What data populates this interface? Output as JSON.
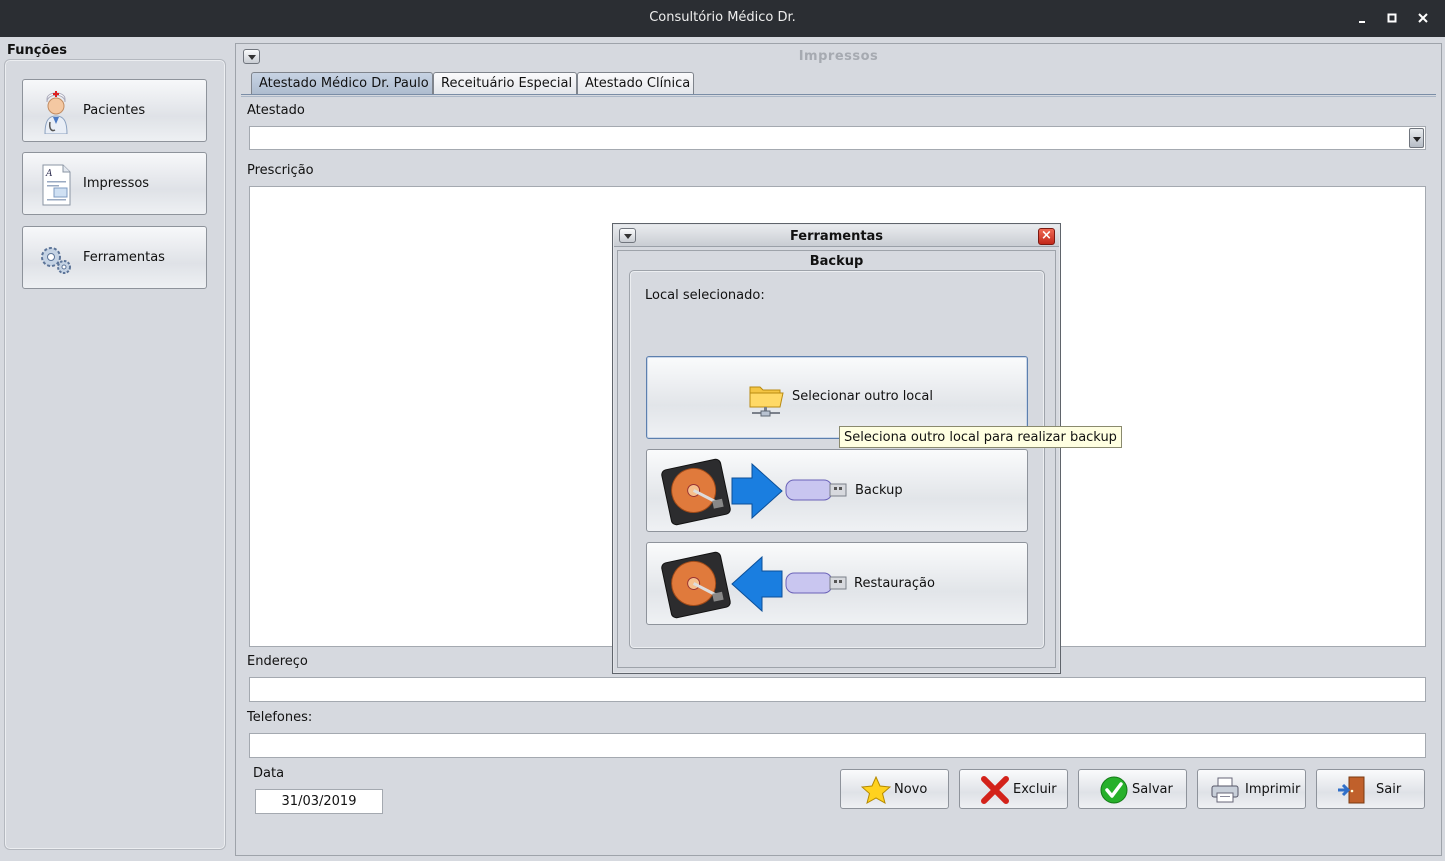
{
  "window": {
    "title": "Consultório Médico Dr.",
    "buttons": [
      "minimize",
      "maximize",
      "close"
    ]
  },
  "sidebar": {
    "title": "Funções",
    "items": [
      {
        "label": "Pacientes",
        "icon": "doctor-icon"
      },
      {
        "label": "Impressos",
        "icon": "document-icon"
      },
      {
        "label": "Ferramentas",
        "icon": "gears-icon"
      }
    ]
  },
  "main": {
    "frame_title": "Impressos",
    "tabs": [
      {
        "label": "Atestado Médico Dr. Paulo",
        "active": true
      },
      {
        "label": "Receituário Especial",
        "active": false
      },
      {
        "label": "Atestado Clínica",
        "active": false
      }
    ],
    "atestado_label": "Atestado",
    "atestado_value": "",
    "prescricao_label": "Prescrição",
    "endereco_label": "Endereço",
    "endereco_value": "",
    "telefones_label": "Telefones:",
    "telefones_value": "",
    "data_label": "Data",
    "data_value": "31/03/2019",
    "actions": [
      {
        "label": "Novo",
        "icon": "star-icon"
      },
      {
        "label": "Excluir",
        "icon": "red-x-icon"
      },
      {
        "label": "Salvar",
        "icon": "green-check-icon"
      },
      {
        "label": "Imprimir",
        "icon": "printer-icon"
      },
      {
        "label": "Sair",
        "icon": "exit-door-icon"
      }
    ]
  },
  "dialog": {
    "title": "Ferramentas",
    "section": "Backup",
    "local_label": "Local selecionado:",
    "local_value": "",
    "buttons": [
      {
        "label": "Selecionar outro local",
        "icon": "network-folder-icon"
      },
      {
        "label": "Backup",
        "icon": "hdd-to-usb-icon"
      },
      {
        "label": "Restauração",
        "icon": "usb-to-hdd-icon"
      }
    ],
    "tooltip": "Seleciona outro local para realizar backup"
  },
  "colors": {
    "titlebar_bg": "#2b2e33",
    "panel_bg": "#d6d9df",
    "active_tab": "#aebccf",
    "tooltip_bg": "#ffffe1",
    "close_red": "#c2281a"
  }
}
